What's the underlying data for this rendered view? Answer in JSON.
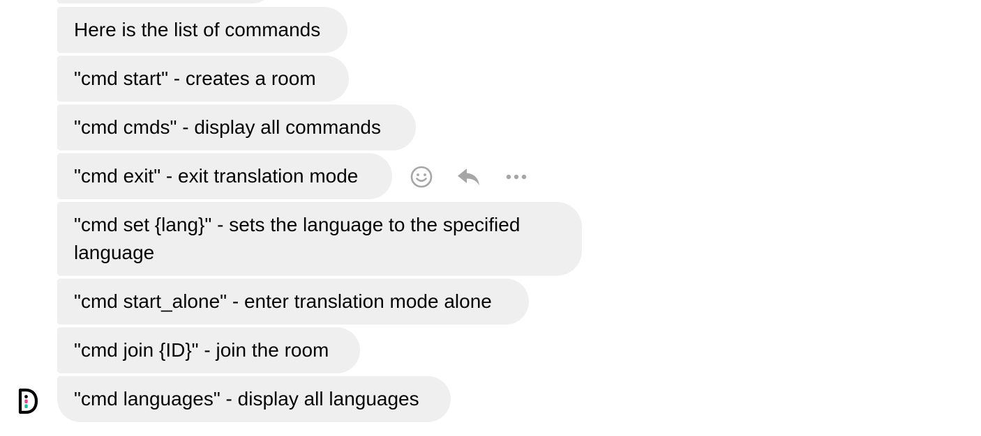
{
  "messages": [
    {
      "text": "Here is the list of commands"
    },
    {
      "text": "\"cmd start\" - creates a room"
    },
    {
      "text": "\"cmd cmds\" - display all commands"
    },
    {
      "text": "\"cmd exit\" - exit translation mode"
    },
    {
      "text": "\"cmd set {lang}\" - sets the language to the specified language"
    },
    {
      "text": "\"cmd start_alone\" - enter translation mode alone"
    },
    {
      "text": "\"cmd join {ID}\" - join the room"
    },
    {
      "text": "\"cmd languages\" - display all languages"
    }
  ],
  "hover_actions": {
    "icons": [
      "smiley-icon",
      "reply-icon",
      "more-icon"
    ]
  },
  "colors": {
    "bubble_background": "#efefef",
    "text": "#050505",
    "icon": "#a6a6a6",
    "avatar_accent_pink": "#e84393",
    "avatar_accent_teal": "#1abc9c"
  },
  "avatar": {
    "icon": "bot-logo-icon"
  }
}
